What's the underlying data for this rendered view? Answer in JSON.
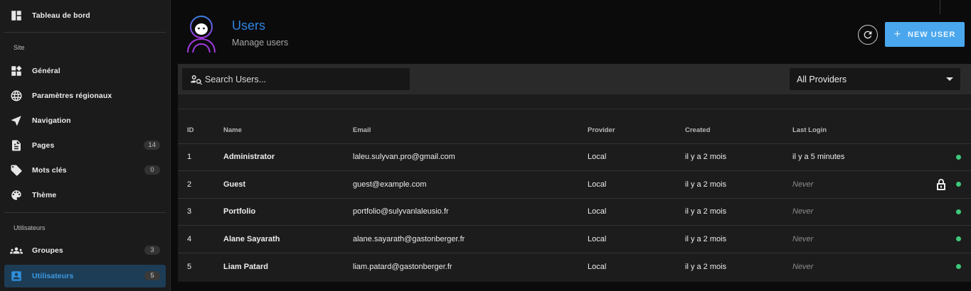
{
  "sidebar": {
    "dashboard": {
      "label": "Tableau de bord",
      "icon": "dashboard-icon"
    },
    "section_site": "Site",
    "items_site": [
      {
        "label": "Général",
        "icon": "widgets-icon"
      },
      {
        "label": "Paramètres régionaux",
        "icon": "globe-icon"
      },
      {
        "label": "Navigation",
        "icon": "navigation-arrow-icon"
      },
      {
        "label": "Pages",
        "icon": "page-icon",
        "badge": "14"
      },
      {
        "label": "Mots clés",
        "icon": "tags-icon",
        "badge": "0"
      },
      {
        "label": "Thème",
        "icon": "palette-icon"
      }
    ],
    "section_users": "Utilisateurs",
    "items_users": [
      {
        "label": "Groupes",
        "icon": "groups-icon",
        "badge": "3"
      },
      {
        "label": "Utilisateurs",
        "icon": "account-box-icon",
        "badge": "5",
        "active": true
      }
    ]
  },
  "header": {
    "title": "Users",
    "subtitle": "Manage users",
    "new_user_label": "NEW USER",
    "new_user_icon": "+"
  },
  "toolbar": {
    "search_placeholder": "Search Users...",
    "provider_selected": "All Providers"
  },
  "table": {
    "columns": [
      "ID",
      "Name",
      "Email",
      "Provider",
      "Created",
      "Last Login"
    ],
    "rows": [
      {
        "id": "1",
        "name": "Administrator",
        "email": "laleu.sulyvan.pro@gmail.com",
        "provider": "Local",
        "created": "il y a 2 mois",
        "last_login": "il y a 5 minutes",
        "never": false,
        "locked": false,
        "status": "active"
      },
      {
        "id": "2",
        "name": "Guest",
        "email": "guest@example.com",
        "provider": "Local",
        "created": "il y a 2 mois",
        "last_login": "Never",
        "never": true,
        "locked": true,
        "status": "active"
      },
      {
        "id": "3",
        "name": "Portfolio",
        "email": "portfolio@sulyvanlaleusio.fr",
        "provider": "Local",
        "created": "il y a 2 mois",
        "last_login": "Never",
        "never": true,
        "locked": false,
        "status": "active"
      },
      {
        "id": "4",
        "name": "Alane Sayarath",
        "email": "alane.sayarath@gastonberger.fr",
        "provider": "Local",
        "created": "il y a 2 mois",
        "last_login": "Never",
        "never": true,
        "locked": false,
        "status": "active"
      },
      {
        "id": "5",
        "name": "Liam Patard",
        "email": "liam.patard@gastonberger.fr",
        "provider": "Local",
        "created": "il y a 2 mois",
        "last_login": "Never",
        "never": true,
        "locked": false,
        "status": "active"
      }
    ]
  },
  "colors": {
    "accent": "#2f83e0",
    "button": "#4aa7ee",
    "status_active": "#3ec97a",
    "active_nav_bg": "#1d3d57"
  }
}
